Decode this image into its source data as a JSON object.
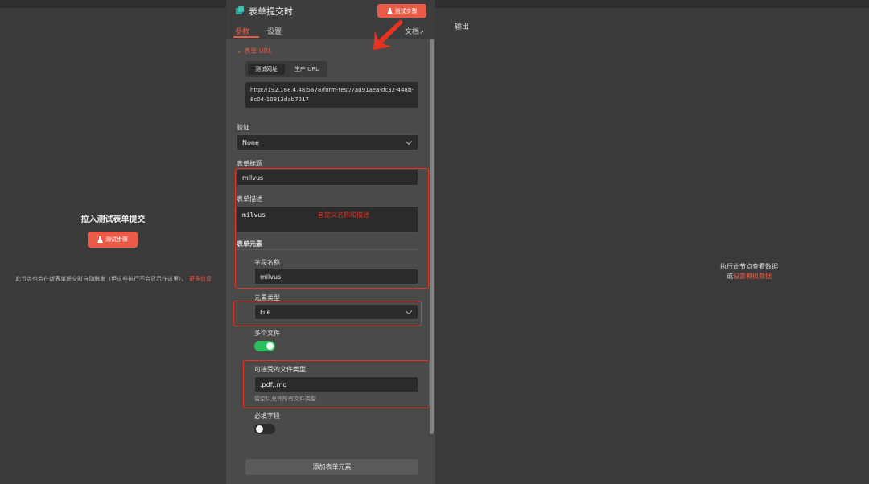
{
  "left_panel": {
    "title": "拉入测试表单提交",
    "test_button": "测试步骤",
    "info_text": "此节点也会在新表单提交时自动触发（但这些执行不会显示在这里）。",
    "info_link": "更多信息"
  },
  "node": {
    "title": "表单提交时",
    "test_button": "测试步骤",
    "tabs": [
      "参数",
      "设置"
    ],
    "docs_link": "文档",
    "form_url_section": "表单 URL",
    "url_toggle": [
      "测试网址",
      "生产 URL"
    ],
    "url_value": "http://192.168.4.48:5678/form-test/7ad91aea-dc32-448b-8c04-10813dab7217",
    "auth": {
      "label": "验证",
      "value": "None"
    },
    "form_title": {
      "label": "表单标题",
      "value": "milvus"
    },
    "form_desc": {
      "label": "表单描述",
      "value": "milvus"
    },
    "annotation": "自定义名称和描述",
    "form_elements_label": "表单元素",
    "field_name": {
      "label": "字段名称",
      "value": "milvus"
    },
    "element_type": {
      "label": "元素类型",
      "value": "File"
    },
    "multiple_files": {
      "label": "多个文件",
      "on": true
    },
    "accepted_types": {
      "label": "可接受的文件类型",
      "value": ".pdf,.md",
      "hint": "留空以允许所有文件类型"
    },
    "required_field": {
      "label": "必填字段",
      "on": false
    },
    "add_element_button": "添加表单元素"
  },
  "output_panel": {
    "title": "输出",
    "empty_line1": "执行此节点查看数据",
    "empty_line2_prefix": "或",
    "empty_line2_link": "设置模拟数据"
  },
  "colors": {
    "accent": "#ea5a47",
    "annotation_red": "#e8321f",
    "toggle_on": "#2bbf5c"
  }
}
